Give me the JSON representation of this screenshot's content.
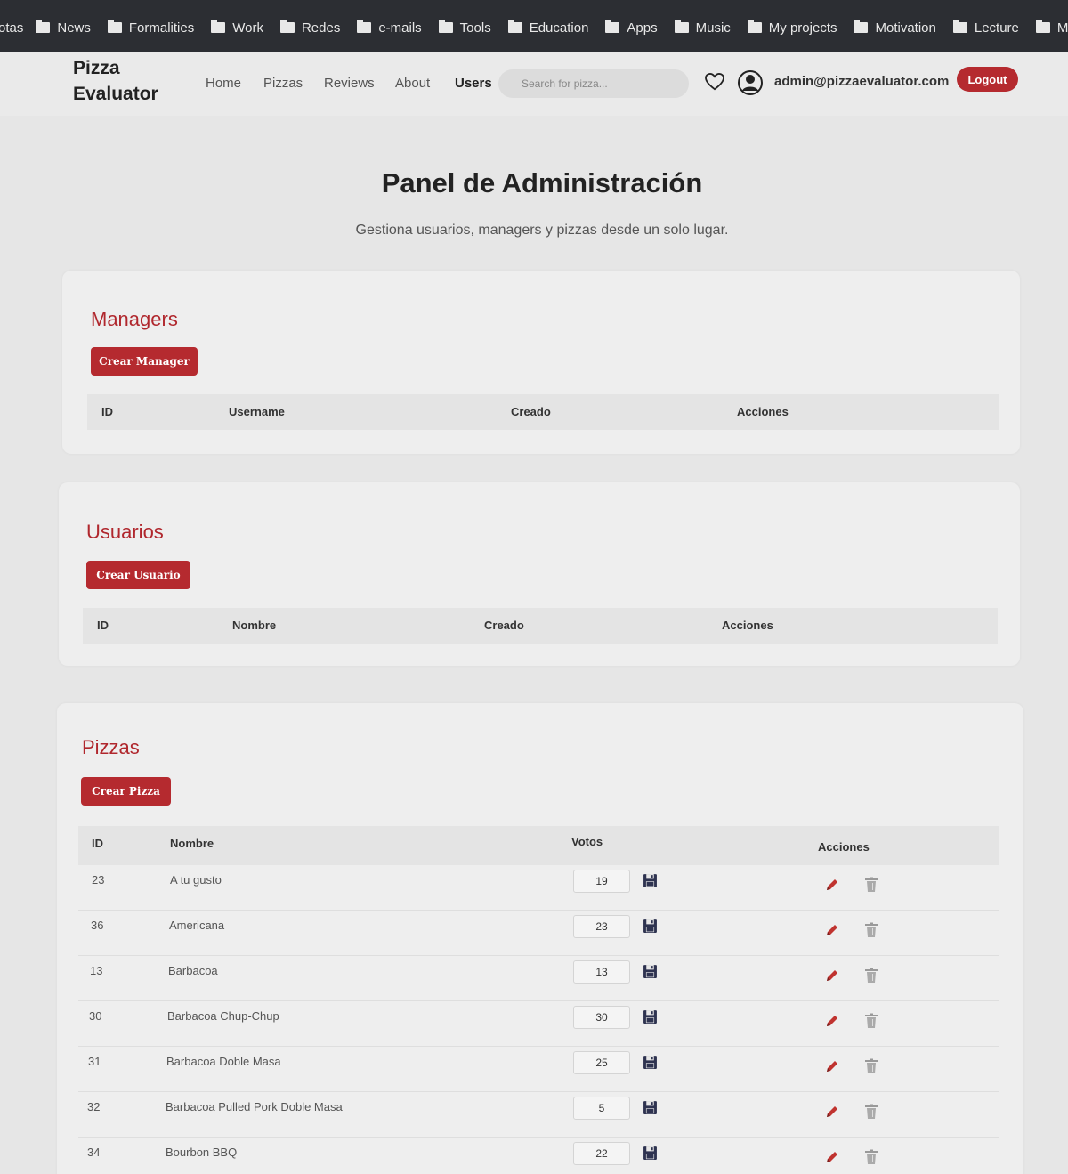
{
  "bookmarks": {
    "first": "otas",
    "items": [
      "News",
      "Formalities",
      "Work",
      "Redes",
      "e-mails",
      "Tools",
      "Education",
      "Apps",
      "Music",
      "My projects",
      "Motivation",
      "Lecture",
      "M"
    ]
  },
  "navbar": {
    "brand_line1": "Pizza",
    "brand_line2": "Evaluator",
    "links": [
      "Home",
      "Pizzas",
      "Reviews",
      "About",
      "Users"
    ],
    "search_placeholder": "Search for pizza...",
    "email": "admin@pizzaevaluator.com",
    "logout_label": "Logout"
  },
  "header": {
    "title": "Panel de Administración",
    "subtitle": "Gestiona usuarios, managers y pizzas desde un solo lugar."
  },
  "managers": {
    "title": "Managers",
    "create_label": "Crear Manager",
    "columns": [
      "ID",
      "Username",
      "Creado",
      "Acciones"
    ]
  },
  "usuarios": {
    "title": "Usuarios",
    "create_label": "Crear Usuario",
    "columns": [
      "ID",
      "Nombre",
      "Creado",
      "Acciones"
    ]
  },
  "pizzas": {
    "title": "Pizzas",
    "create_label": "Crear Pizza",
    "columns": [
      "ID",
      "Nombre",
      "Votos",
      "Acciones"
    ],
    "rows": [
      {
        "id": "23",
        "name": "A tu gusto",
        "votes": "19"
      },
      {
        "id": "36",
        "name": "Americana",
        "votes": "23"
      },
      {
        "id": "13",
        "name": "Barbacoa",
        "votes": "13"
      },
      {
        "id": "30",
        "name": "Barbacoa Chup-Chup",
        "votes": "30"
      },
      {
        "id": "31",
        "name": "Barbacoa Doble Masa",
        "votes": "25"
      },
      {
        "id": "32",
        "name": "Barbacoa Pulled Pork Doble Masa",
        "votes": "5"
      },
      {
        "id": "34",
        "name": "Bourbon BBQ",
        "votes": "22"
      }
    ]
  },
  "colors": {
    "accent": "#b52a2f",
    "bookmarks_bg": "#2c2e33",
    "page_bg": "#e6e6e6"
  }
}
